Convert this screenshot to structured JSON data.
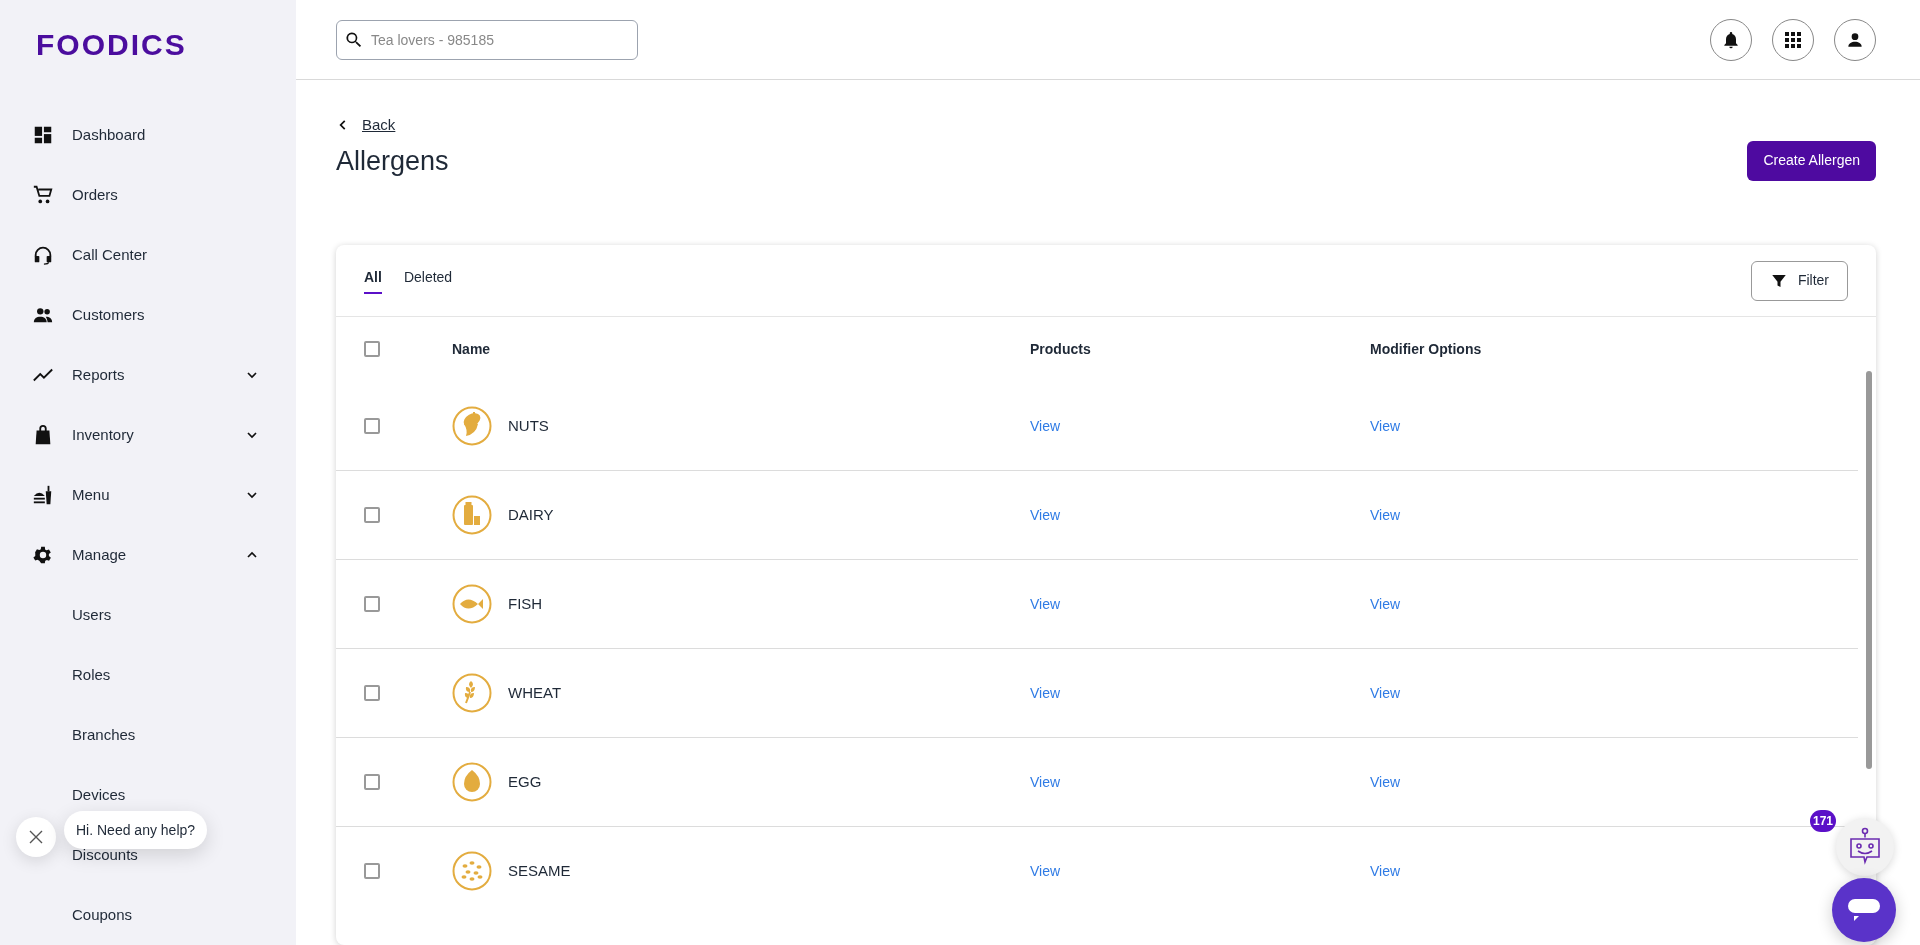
{
  "brand": "FOODICS",
  "sidebar": {
    "items": [
      {
        "label": "Dashboard"
      },
      {
        "label": "Orders"
      },
      {
        "label": "Call Center"
      },
      {
        "label": "Customers"
      },
      {
        "label": "Reports",
        "expanded": false
      },
      {
        "label": "Inventory",
        "expanded": false
      },
      {
        "label": "Menu",
        "expanded": false
      },
      {
        "label": "Manage",
        "expanded": true,
        "children": [
          {
            "label": "Users"
          },
          {
            "label": "Roles"
          },
          {
            "label": "Branches"
          },
          {
            "label": "Devices"
          },
          {
            "label": "Discounts"
          },
          {
            "label": "Coupons"
          }
        ]
      }
    ]
  },
  "search": {
    "placeholder": "Tea lovers - 985185"
  },
  "back_link": "Back",
  "page_title": "Allergens",
  "create_button": "Create Allergen",
  "tabs": [
    {
      "label": "All",
      "selected": true
    },
    {
      "label": "Deleted",
      "selected": false
    }
  ],
  "filter_button": "Filter",
  "table": {
    "all_checked": false,
    "columns": [
      "Name",
      "Products",
      "Modifier Options"
    ],
    "rows": [
      {
        "name": "NUTS",
        "checked": false,
        "products": "View",
        "modifier_options": "View"
      },
      {
        "name": "DAIRY",
        "checked": false,
        "products": "View",
        "modifier_options": "View"
      },
      {
        "name": "FISH",
        "checked": false,
        "products": "View",
        "modifier_options": "View"
      },
      {
        "name": "WHEAT",
        "checked": false,
        "products": "View",
        "modifier_options": "View"
      },
      {
        "name": "EGG",
        "checked": false,
        "products": "View",
        "modifier_options": "View"
      },
      {
        "name": "SESAME",
        "checked": false,
        "products": "View",
        "modifier_options": "View"
      }
    ]
  },
  "help_bubble": "Hi. Need any help?",
  "chat_badge": "171"
}
